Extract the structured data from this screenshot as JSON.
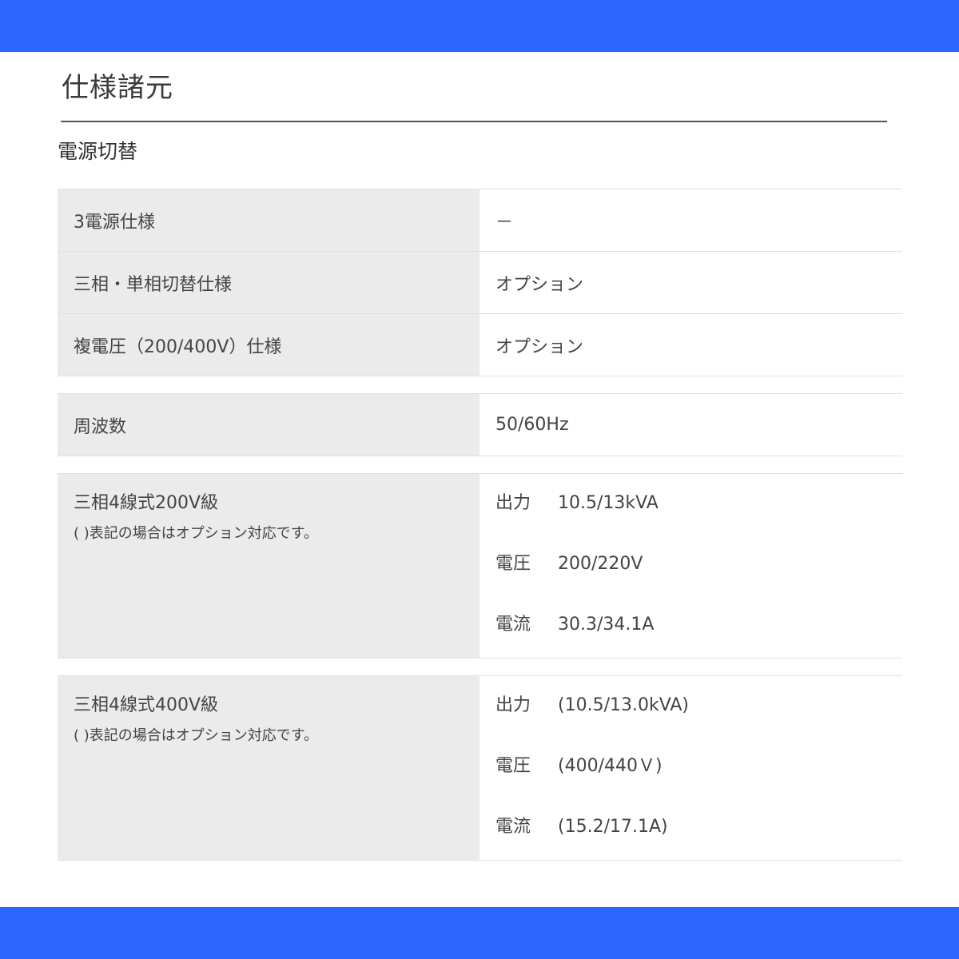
{
  "page_title": "仕様諸元",
  "section_title": "電源切替",
  "table1": [
    {
      "label": "3電源仕様",
      "value": "－"
    },
    {
      "label": "三相・単相切替仕様",
      "value": "オプション"
    },
    {
      "label": "複電圧（200/400V）仕様",
      "value": "オプション"
    }
  ],
  "table2": [
    {
      "label": "周波数",
      "value": "50/60Hz"
    }
  ],
  "table3": {
    "label": "三相4線式200V級",
    "note": "( )表記の場合はオプション対応です。",
    "items": [
      {
        "key": "出力",
        "value": "10.5/13kVA"
      },
      {
        "key": "電圧",
        "value": "200/220V"
      },
      {
        "key": "電流",
        "value": "30.3/34.1A"
      }
    ]
  },
  "table4": {
    "label": "三相4線式400V級",
    "note": "( )表記の場合はオプション対応です。",
    "items": [
      {
        "key": "出力",
        "value": "(10.5/13.0kVA)"
      },
      {
        "key": "電圧",
        "value": "(400/440Ｖ)"
      },
      {
        "key": "電流",
        "value": "(15.2/17.1A)"
      }
    ]
  },
  "colors": {
    "band": "#2a66ff",
    "label_bg": "#ebebeb",
    "rule": "#555555"
  }
}
